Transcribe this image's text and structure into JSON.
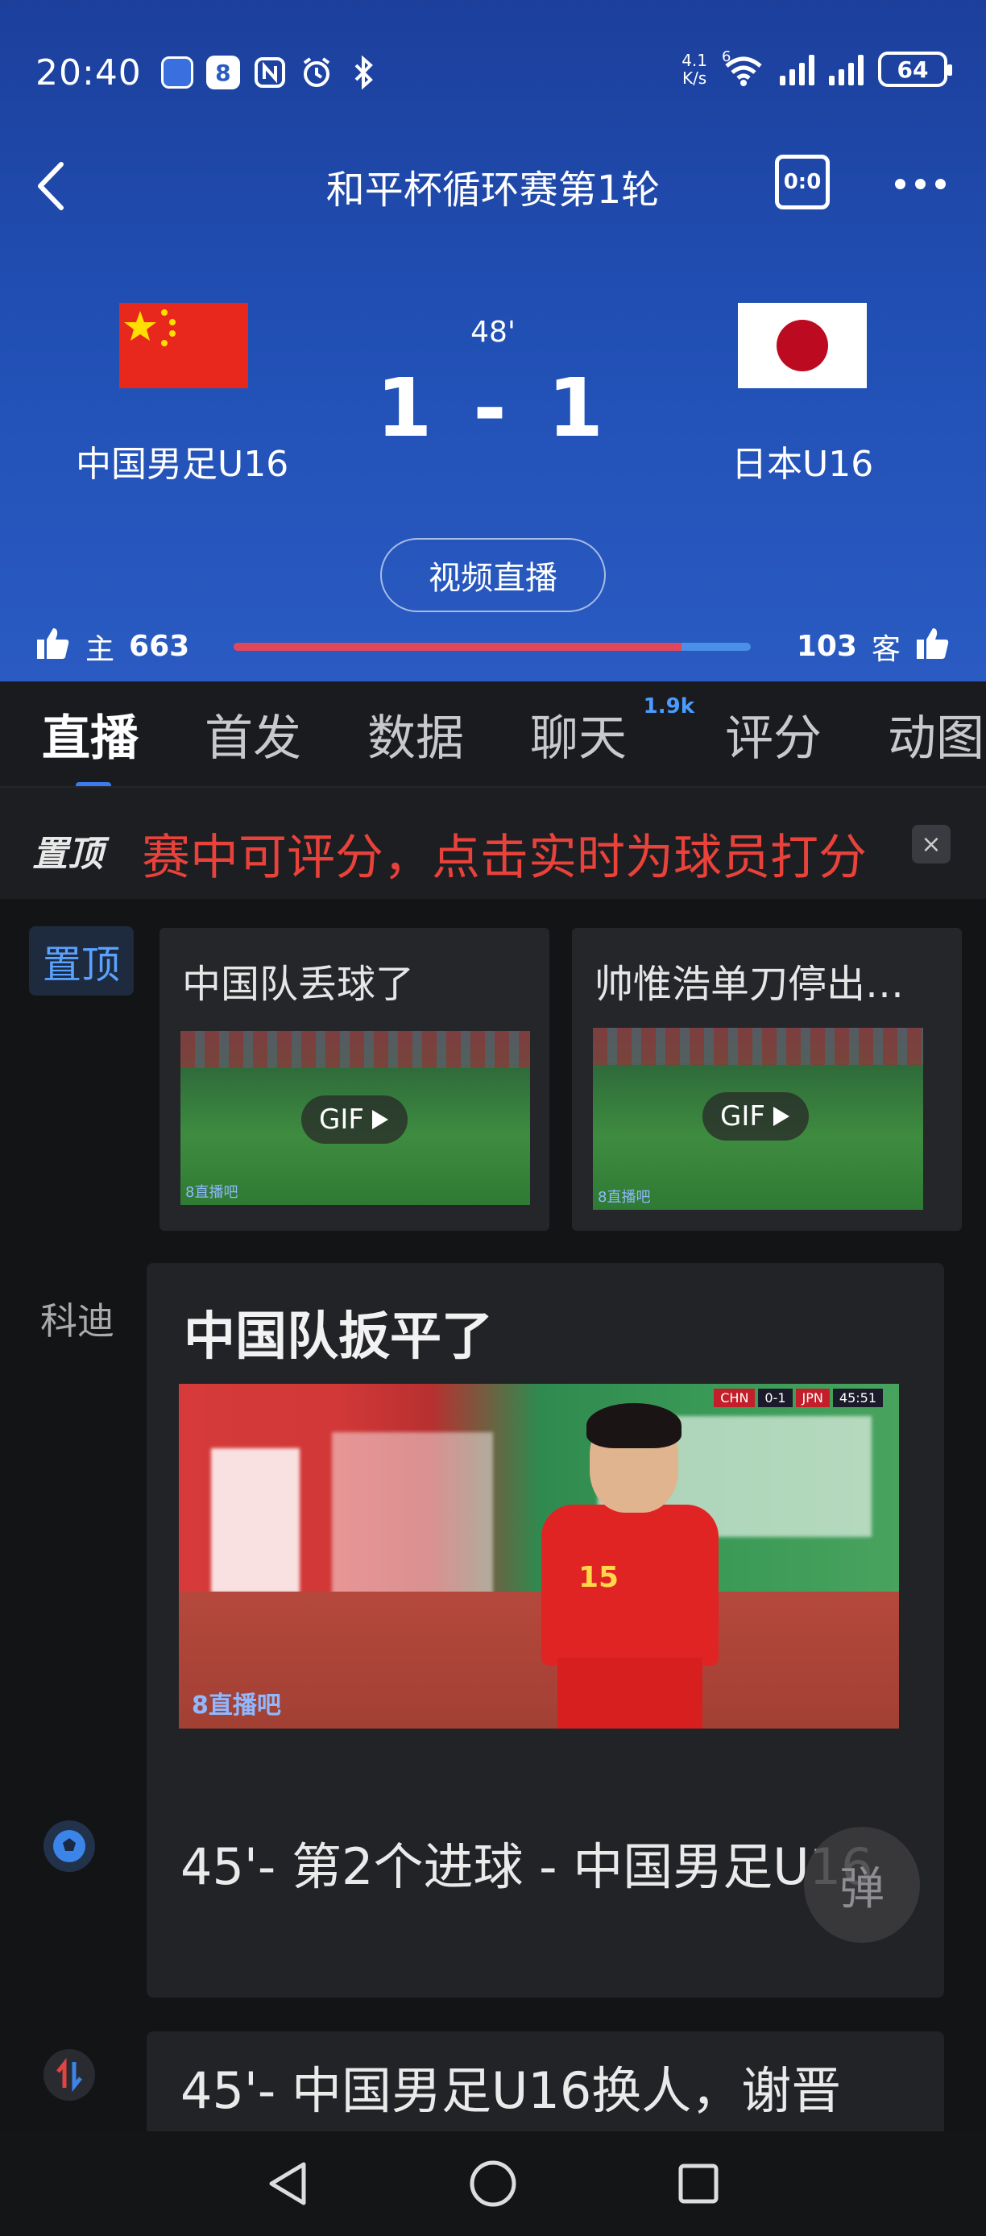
{
  "status_bar": {
    "time": "20:40",
    "net_speed_value": "4.1",
    "net_speed_unit": "K/s",
    "wifi_label": "6",
    "battery": "64"
  },
  "header": {
    "title": "和平杯循环赛第1轮",
    "score_icon_label": "0:0"
  },
  "match": {
    "home_team": "中国男足U16",
    "away_team": "日本U16",
    "minute": "48'",
    "score": "1 - 1",
    "live_button": "视频直播",
    "home_vote_label": "主",
    "home_votes": "663",
    "away_vote_label": "客",
    "away_votes": "103",
    "home_share": 0.866
  },
  "tabs": [
    {
      "label": "直播",
      "active": true
    },
    {
      "label": "首发"
    },
    {
      "label": "数据"
    },
    {
      "label": "聊天",
      "badge": "1.9k"
    },
    {
      "label": "评分"
    },
    {
      "label": "动图"
    }
  ],
  "pinned": {
    "label": "置顶",
    "text": "赛中可评分，点击实时为球员打分",
    "close": "×"
  },
  "feed": {
    "pin_tag": "置顶",
    "gif_cards": [
      {
        "title": "中国队丢球了",
        "badge": "GIF"
      },
      {
        "title": "帅惟浩单刀停出…",
        "badge": "GIF"
      }
    ],
    "watermark": "8直播吧",
    "post": {
      "author": "科迪",
      "title": "中国队扳平了",
      "scorebug": [
        "CHN",
        "0-1",
        "JPN",
        "45:51"
      ],
      "jersey_number": "15"
    },
    "events": [
      {
        "text": "45'- 第2个进球 - 中国男足U16"
      },
      {
        "text": "45'- 中国男足U16换人，谢晋"
      }
    ],
    "danmu_button": "弹"
  }
}
